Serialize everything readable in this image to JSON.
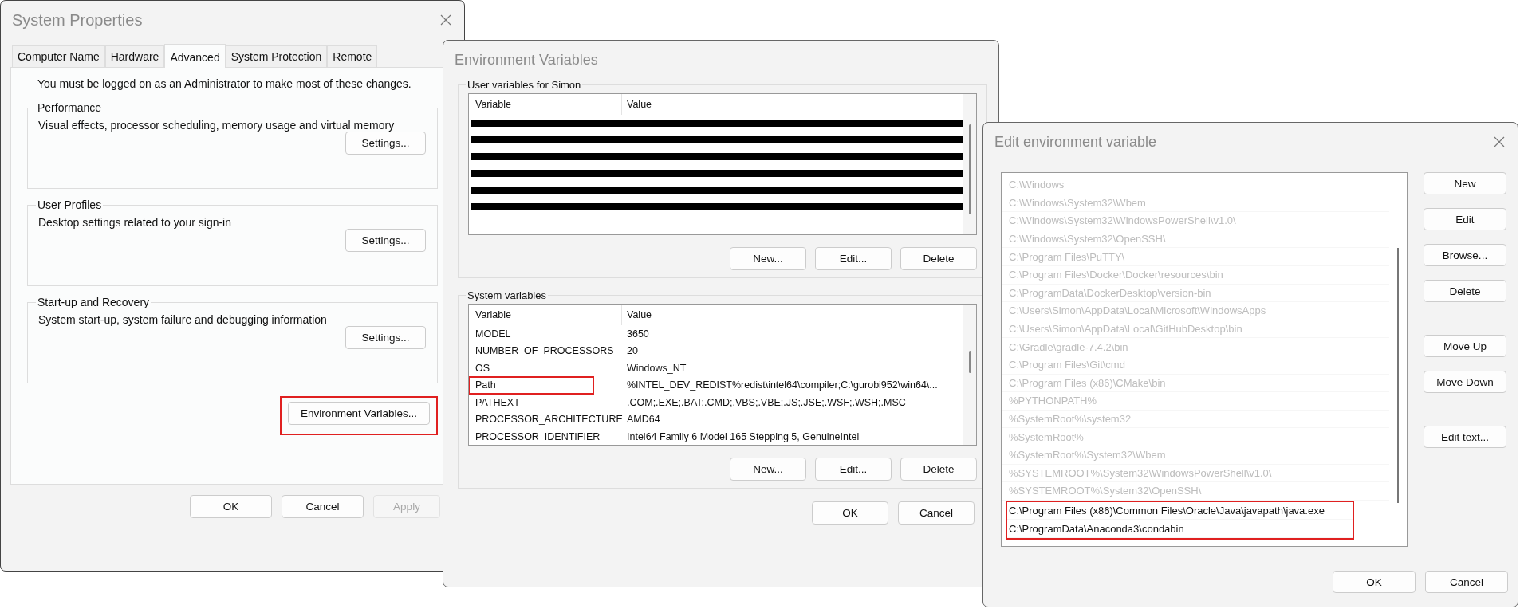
{
  "system_properties": {
    "title": "System Properties",
    "tabs": [
      {
        "label": "Computer Name",
        "selected": false
      },
      {
        "label": "Hardware",
        "selected": false
      },
      {
        "label": "Advanced",
        "selected": true
      },
      {
        "label": "System Protection",
        "selected": false
      },
      {
        "label": "Remote",
        "selected": false
      }
    ],
    "notice": "You must be logged on as an Administrator to make most of these changes.",
    "groups": [
      {
        "title": "Performance",
        "description": "Visual effects, processor scheduling, memory usage and virtual memory",
        "button": "Settings..."
      },
      {
        "title": "User Profiles",
        "description": "Desktop settings related to your sign-in",
        "button": "Settings..."
      },
      {
        "title": "Start-up and Recovery",
        "description": "System start-up, system failure and debugging information",
        "button": "Settings..."
      }
    ],
    "env_button": {
      "label": "Environment Variables...",
      "highlighted": true
    },
    "buttons": [
      {
        "label": "OK",
        "disabled": false
      },
      {
        "label": "Cancel",
        "disabled": false
      },
      {
        "label": "Apply",
        "disabled": true
      }
    ]
  },
  "environment_variables": {
    "title": "Environment Variables",
    "user_group": {
      "title": "User variables for Simon",
      "columns": [
        "Variable",
        "Value"
      ],
      "rows": [
        {
          "kind": "redacted"
        },
        {
          "kind": "redacted"
        },
        {
          "kind": "redacted"
        },
        {
          "kind": "redacted"
        },
        {
          "kind": "redacted"
        },
        {
          "kind": "redacted"
        }
      ],
      "buttons": [
        "New...",
        "Edit...",
        "Delete"
      ]
    },
    "system_group": {
      "title": "System variables",
      "columns": [
        "Variable",
        "Value"
      ],
      "rows": [
        {
          "kind": "text",
          "variable": "MODEL",
          "value": "3650",
          "highlighted": false
        },
        {
          "kind": "text",
          "variable": "NUMBER_OF_PROCESSORS",
          "value": "20",
          "highlighted": false
        },
        {
          "kind": "text",
          "variable": "OS",
          "value": "Windows_NT",
          "highlighted": false
        },
        {
          "kind": "text",
          "variable": "Path",
          "value": "%INTEL_DEV_REDIST%redist\\intel64\\compiler;C:\\gurobi952\\win64\\...",
          "highlighted": true
        },
        {
          "kind": "text",
          "variable": "PATHEXT",
          "value": ".COM;.EXE;.BAT;.CMD;.VBS;.VBE;.JS;.JSE;.WSF;.WSH;.MSC",
          "highlighted": false
        },
        {
          "kind": "text",
          "variable": "PROCESSOR_ARCHITECTURE",
          "value": "AMD64",
          "highlighted": false
        },
        {
          "kind": "text",
          "variable": "PROCESSOR_IDENTIFIER",
          "value": "Intel64 Family 6 Model 165 Stepping 5, GenuineIntel",
          "highlighted": false
        }
      ],
      "buttons": [
        "New...",
        "Edit...",
        "Delete"
      ]
    },
    "buttons": [
      "OK",
      "Cancel"
    ]
  },
  "edit_variable": {
    "title": "Edit environment variable",
    "entries": [
      {
        "text": "C:\\Windows",
        "dimmed": true,
        "highlighted": false
      },
      {
        "text": "C:\\Windows\\System32\\Wbem",
        "dimmed": true,
        "highlighted": false
      },
      {
        "text": "C:\\Windows\\System32\\WindowsPowerShell\\v1.0\\",
        "dimmed": true,
        "highlighted": false
      },
      {
        "text": "C:\\Windows\\System32\\OpenSSH\\",
        "dimmed": true,
        "highlighted": false
      },
      {
        "text": "C:\\Program Files\\PuTTY\\",
        "dimmed": true,
        "highlighted": false
      },
      {
        "text": "C:\\Program Files\\Docker\\Docker\\resources\\bin",
        "dimmed": true,
        "highlighted": false
      },
      {
        "text": "C:\\ProgramData\\DockerDesktop\\version-bin",
        "dimmed": true,
        "highlighted": false
      },
      {
        "text": "C:\\Users\\Simon\\AppData\\Local\\Microsoft\\WindowsApps",
        "dimmed": true,
        "highlighted": false
      },
      {
        "text": "C:\\Users\\Simon\\AppData\\Local\\GitHubDesktop\\bin",
        "dimmed": true,
        "highlighted": false
      },
      {
        "text": "C:\\Gradle\\gradle-7.4.2\\bin",
        "dimmed": true,
        "highlighted": false
      },
      {
        "text": "C:\\Program Files\\Git\\cmd",
        "dimmed": true,
        "highlighted": false
      },
      {
        "text": "C:\\Program Files (x86)\\CMake\\bin",
        "dimmed": true,
        "highlighted": false
      },
      {
        "text": "%PYTHONPATH%",
        "dimmed": true,
        "highlighted": false
      },
      {
        "text": "%SystemRoot%\\system32",
        "dimmed": true,
        "highlighted": false
      },
      {
        "text": "%SystemRoot%",
        "dimmed": true,
        "highlighted": false
      },
      {
        "text": "%SystemRoot%\\System32\\Wbem",
        "dimmed": true,
        "highlighted": false
      },
      {
        "text": "%SYSTEMROOT%\\System32\\WindowsPowerShell\\v1.0\\",
        "dimmed": true,
        "highlighted": false
      },
      {
        "text": "%SYSTEMROOT%\\System32\\OpenSSH\\",
        "dimmed": true,
        "highlighted": false
      },
      {
        "text": "C:\\Program Files (x86)\\Common Files\\Oracle\\Java\\javapath\\java.exe",
        "dimmed": false,
        "highlighted": true
      },
      {
        "text": "C:\\ProgramData\\Anaconda3\\condabin",
        "dimmed": false,
        "highlighted": true
      }
    ],
    "buttons": [
      {
        "kind": "action",
        "label": "New"
      },
      {
        "kind": "action",
        "label": "Edit"
      },
      {
        "kind": "action",
        "label": "Browse..."
      },
      {
        "kind": "action",
        "label": "Delete"
      },
      {
        "kind": "spaced",
        "label": "Move Up"
      },
      {
        "kind": "action",
        "label": "Move Down"
      },
      {
        "kind": "spaced",
        "label": "Edit text..."
      }
    ],
    "footer_buttons": [
      "OK",
      "Cancel"
    ]
  }
}
